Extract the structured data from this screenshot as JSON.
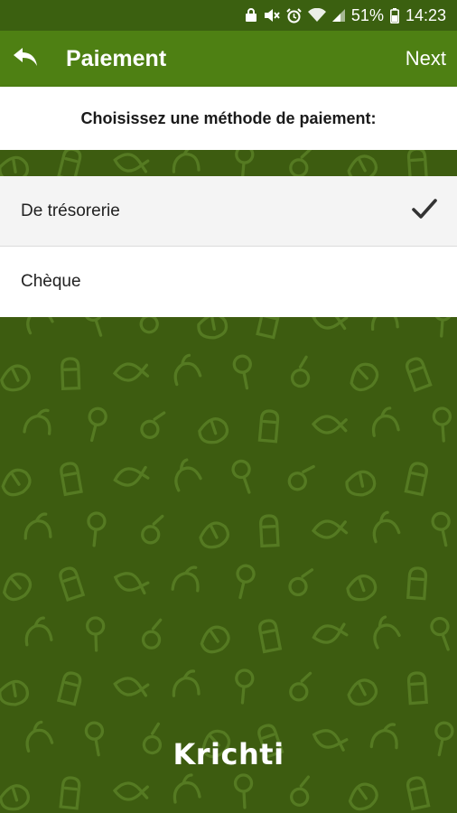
{
  "status_bar": {
    "battery_percent": "51%",
    "time": "14:23",
    "icons": [
      "lock-icon",
      "mute-icon",
      "alarm-icon",
      "wifi-icon",
      "signal-icon",
      "battery-icon"
    ]
  },
  "app_bar": {
    "title": "Paiement",
    "next_label": "Next",
    "back_icon": "back-arrow-icon"
  },
  "prompt": "Choisissez une méthode de paiement:",
  "payment_options": [
    {
      "label": "De trésorerie",
      "selected": true
    },
    {
      "label": "Chèque",
      "selected": false
    }
  ],
  "brand": "Krichti",
  "colors": {
    "app_bar": "#4e8013",
    "status_bar": "#3b6010",
    "background": "#3d5c10"
  }
}
